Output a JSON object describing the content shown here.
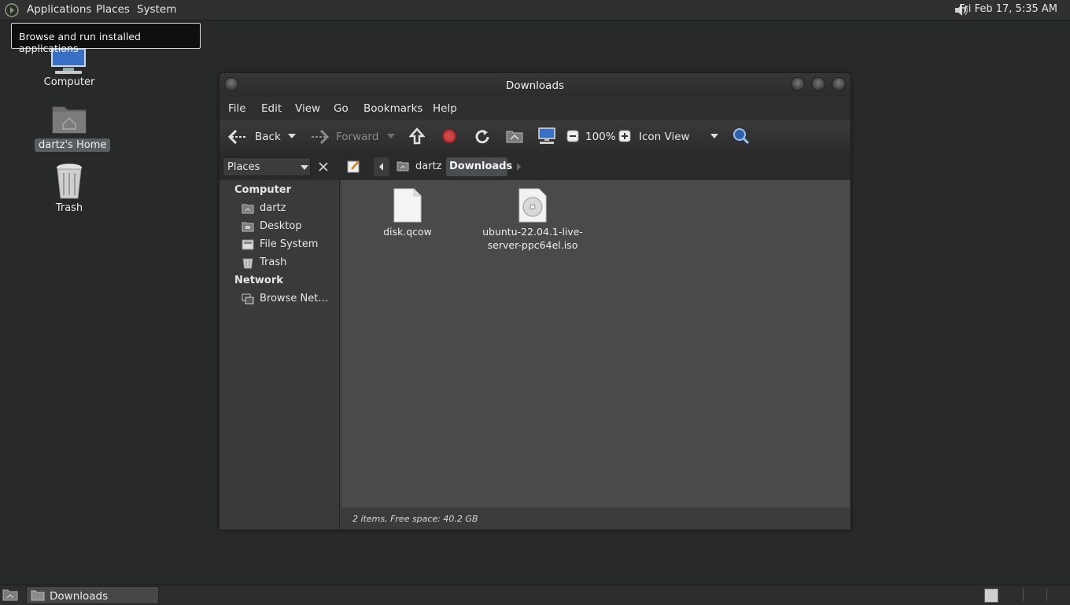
{
  "top_panel": {
    "menus": [
      "Applications",
      "Places",
      "System"
    ],
    "clock": "Fri Feb 17,  5:35 AM"
  },
  "tooltip": "Browse and run installed applications",
  "desktop": {
    "icons": [
      {
        "label": "Computer"
      },
      {
        "label": "dartz's Home"
      },
      {
        "label": "Trash"
      }
    ]
  },
  "window": {
    "title": "Downloads",
    "menubar": [
      "File",
      "Edit",
      "View",
      "Go",
      "Bookmarks",
      "Help"
    ],
    "toolbar": {
      "back": "Back",
      "forward": "Forward",
      "zoom": "100%",
      "view_mode": "Icon View"
    },
    "location": {
      "places_label": "Places",
      "crumbs": [
        "dartz",
        "Downloads"
      ]
    },
    "sidebar": {
      "sections": [
        {
          "title": "Computer",
          "items": [
            "dartz",
            "Desktop",
            "File System",
            "Trash"
          ]
        },
        {
          "title": "Network",
          "items": [
            "Browse Net…"
          ]
        }
      ]
    },
    "files": [
      {
        "name": "disk.qcow",
        "icon": "document-icon"
      },
      {
        "name_line1": "ubuntu-22.04.1-live-",
        "name_line2": "server-ppc64el.iso",
        "icon": "disc-image-icon"
      }
    ],
    "status": "2 items, Free space: 40.2 GB"
  },
  "bottom_panel": {
    "task": "Downloads"
  },
  "colors": {
    "desktop_bg": "#272a28",
    "panel_bg": "#303030",
    "content_bg": "#4a4a4a",
    "stop_red": "#c0392b"
  }
}
